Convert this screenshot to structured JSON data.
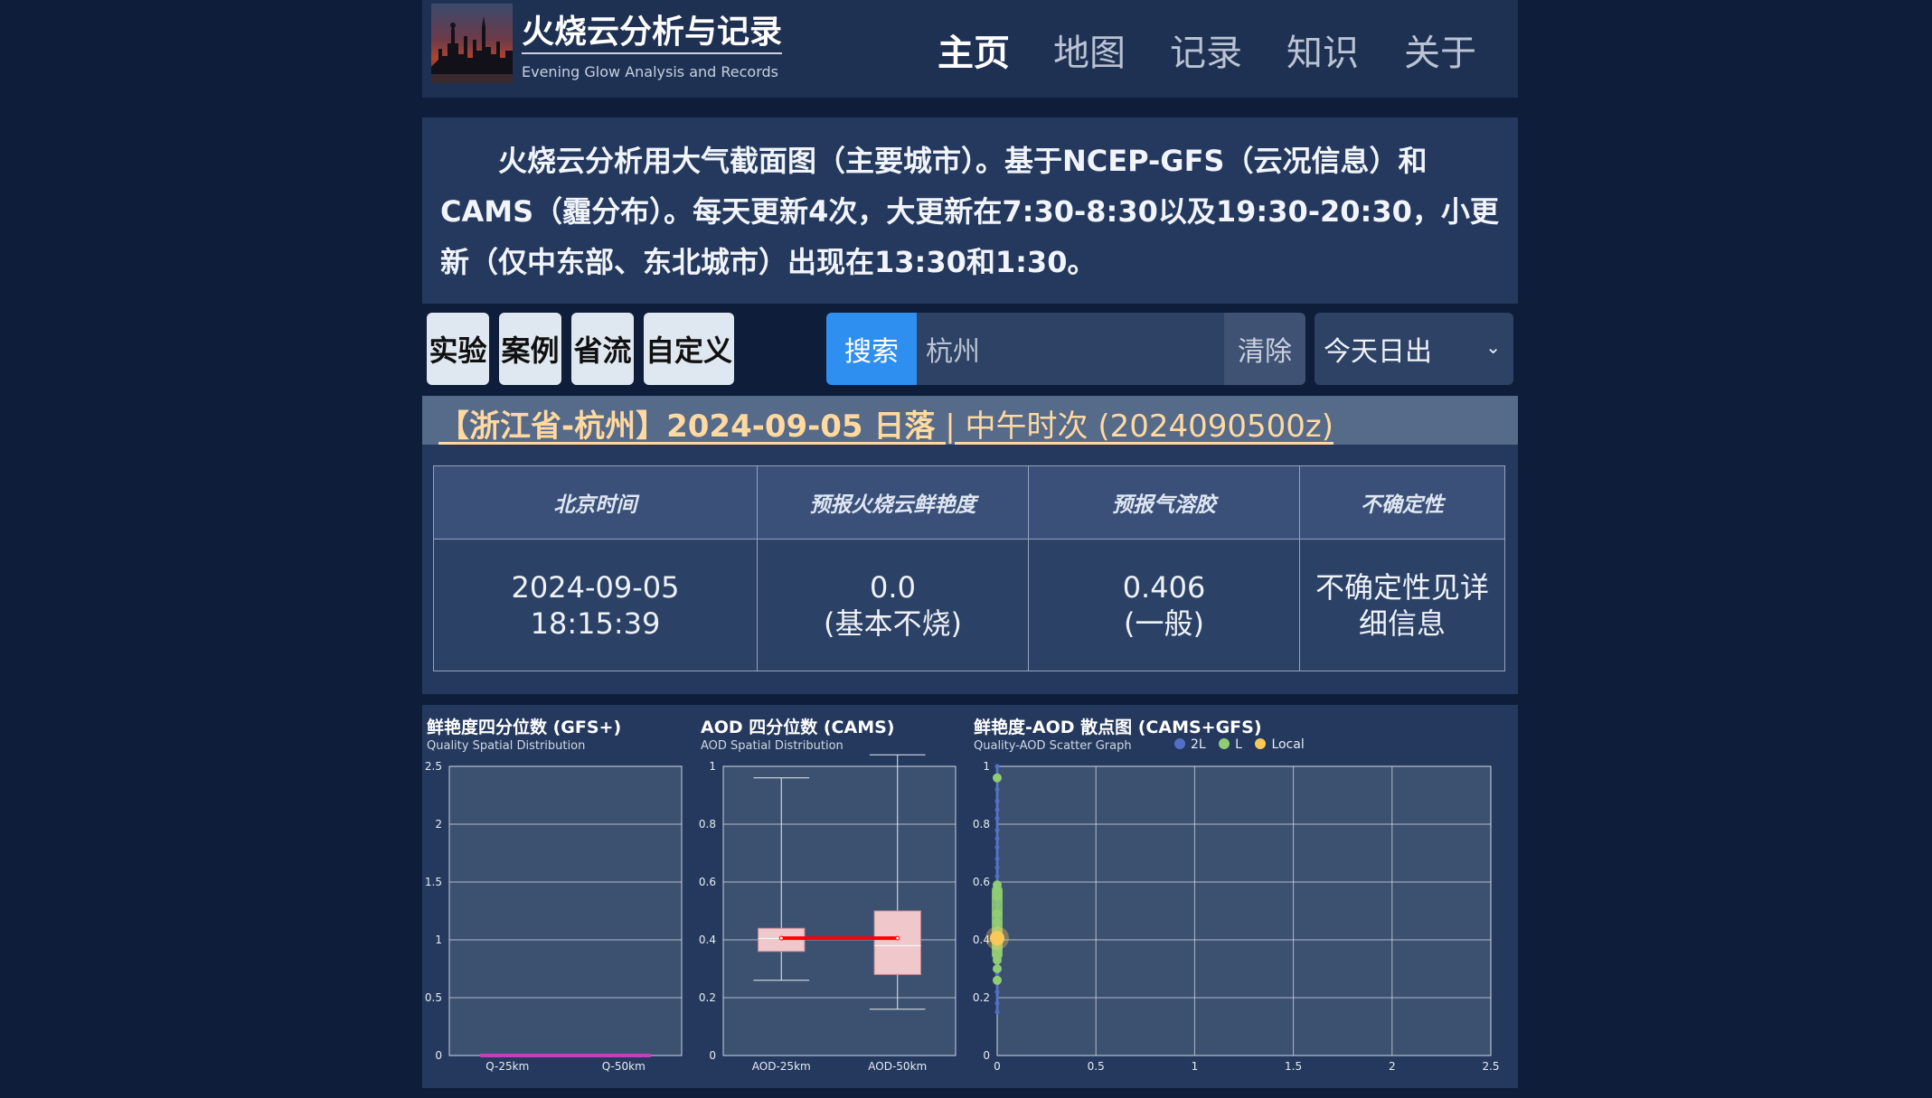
{
  "header": {
    "title": "火烧云分析与记录",
    "subtitle": "Evening Glow Analysis and Records",
    "nav": [
      {
        "label": "主页",
        "active": true
      },
      {
        "label": "地图",
        "active": false
      },
      {
        "label": "记录",
        "active": false
      },
      {
        "label": "知识",
        "active": false
      },
      {
        "label": "关于",
        "active": false
      }
    ]
  },
  "intro": {
    "text": "火烧云分析用大气截面图（主要城市）。基于NCEP-GFS（云况信息）和CAMS（霾分布）。每天更新4次，大更新在7:30-8:30以及19:30-20:30，小更新（仅中东部、东北城市）出现在13:30和1:30。"
  },
  "toolbar": {
    "buttons": [
      "实验",
      "案例",
      "省流",
      "自定义"
    ],
    "search_label": "搜索",
    "search_value": "杭州",
    "clear_label": "清除",
    "select_value": "今天日出",
    "select_icon": "chevron-down-icon"
  },
  "result": {
    "heading_main": "【浙江省-杭州】2024-09-05 日落",
    "heading_run": " | 中午时次 (2024090500z)",
    "columns": [
      "北京时间",
      "预报火烧云鲜艳度",
      "预报气溶胶",
      "不确定性"
    ],
    "row": {
      "time_date": "2024-09-05",
      "time_clock": "18:15:39",
      "quality_value": "0.0",
      "quality_desc": "(基本不烧)",
      "aod_value": "0.406",
      "aod_desc": "(一般)",
      "uncertainty": "不确定性见详细信息"
    }
  },
  "chart_data": [
    {
      "type": "boxplot",
      "title": "鲜艳度四分位数 (GFS+)",
      "subtitle": "Quality Spatial Distribution",
      "categories": [
        "Q-25km",
        "Q-50km"
      ],
      "ylim": [
        0,
        2.5
      ],
      "yticks": [
        0,
        0.5,
        1,
        1.5,
        2,
        2.5
      ],
      "boxes": [
        {
          "min": 0,
          "q1": 0,
          "median": 0,
          "q3": 0,
          "max": 0
        },
        {
          "min": 0,
          "q1": 0,
          "median": 0,
          "q3": 0,
          "max": 0
        }
      ],
      "mean_line": [
        0,
        0
      ],
      "colors": {
        "box": "#e8b8bf",
        "line": "#c040c0"
      }
    },
    {
      "type": "boxplot",
      "title": "AOD 四分位数 (CAMS)",
      "subtitle": "AOD Spatial Distribution",
      "categories": [
        "AOD-25km",
        "AOD-50km"
      ],
      "ylim": [
        0,
        1
      ],
      "yticks": [
        0,
        0.2,
        0.4,
        0.6,
        0.8,
        1
      ],
      "boxes": [
        {
          "min": 0.26,
          "q1": 0.36,
          "median": 0.405,
          "q3": 0.44,
          "max": 0.96
        },
        {
          "min": 0.16,
          "q1": 0.28,
          "median": 0.38,
          "q3": 0.5,
          "max": 1.04
        }
      ],
      "mean_line": [
        0.406,
        0.406
      ],
      "colors": {
        "box": "#f0c8cc",
        "line": "#ff0000"
      }
    },
    {
      "type": "scatter",
      "title": "鲜艳度-AOD 散点图 (CAMS+GFS)",
      "subtitle": "Quality-AOD Scatter Graph",
      "xlim": [
        0,
        2.5
      ],
      "ylim": [
        0,
        1
      ],
      "xticks": [
        0,
        0.5,
        1,
        1.5,
        2,
        2.5
      ],
      "yticks": [
        0,
        0.2,
        0.4,
        0.6,
        0.8,
        1
      ],
      "series": [
        {
          "name": "2L",
          "color": "#5470c6",
          "points": [
            [
              0,
              0.15
            ],
            [
              0,
              0.18
            ],
            [
              0,
              0.22
            ],
            [
              0,
              0.25
            ],
            [
              0,
              0.28
            ],
            [
              0,
              0.3
            ],
            [
              0,
              0.33
            ],
            [
              0,
              0.36
            ],
            [
              0,
              0.38
            ],
            [
              0,
              0.42
            ],
            [
              0,
              0.45
            ],
            [
              0,
              0.48
            ],
            [
              0,
              0.52
            ],
            [
              0,
              0.55
            ],
            [
              0,
              0.58
            ],
            [
              0,
              0.62
            ],
            [
              0,
              0.65
            ],
            [
              0,
              0.68
            ],
            [
              0,
              0.72
            ],
            [
              0,
              0.75
            ],
            [
              0,
              0.78
            ],
            [
              0,
              0.82
            ],
            [
              0,
              0.85
            ],
            [
              0,
              0.88
            ],
            [
              0,
              0.92
            ],
            [
              0,
              0.96
            ],
            [
              0,
              1.0
            ]
          ]
        },
        {
          "name": "L",
          "color": "#91cc75",
          "points": [
            [
              0,
              0.26
            ],
            [
              0,
              0.3
            ],
            [
              0,
              0.33
            ],
            [
              0,
              0.35
            ],
            [
              0,
              0.37
            ],
            [
              0,
              0.43
            ],
            [
              0,
              0.46
            ],
            [
              0,
              0.49
            ],
            [
              0,
              0.55
            ],
            [
              0,
              0.57
            ],
            [
              0,
              0.59
            ],
            [
              0,
              0.96
            ]
          ]
        },
        {
          "name": "Local",
          "color": "#fac858",
          "points": [
            [
              0,
              0.406
            ]
          ]
        }
      ]
    }
  ]
}
